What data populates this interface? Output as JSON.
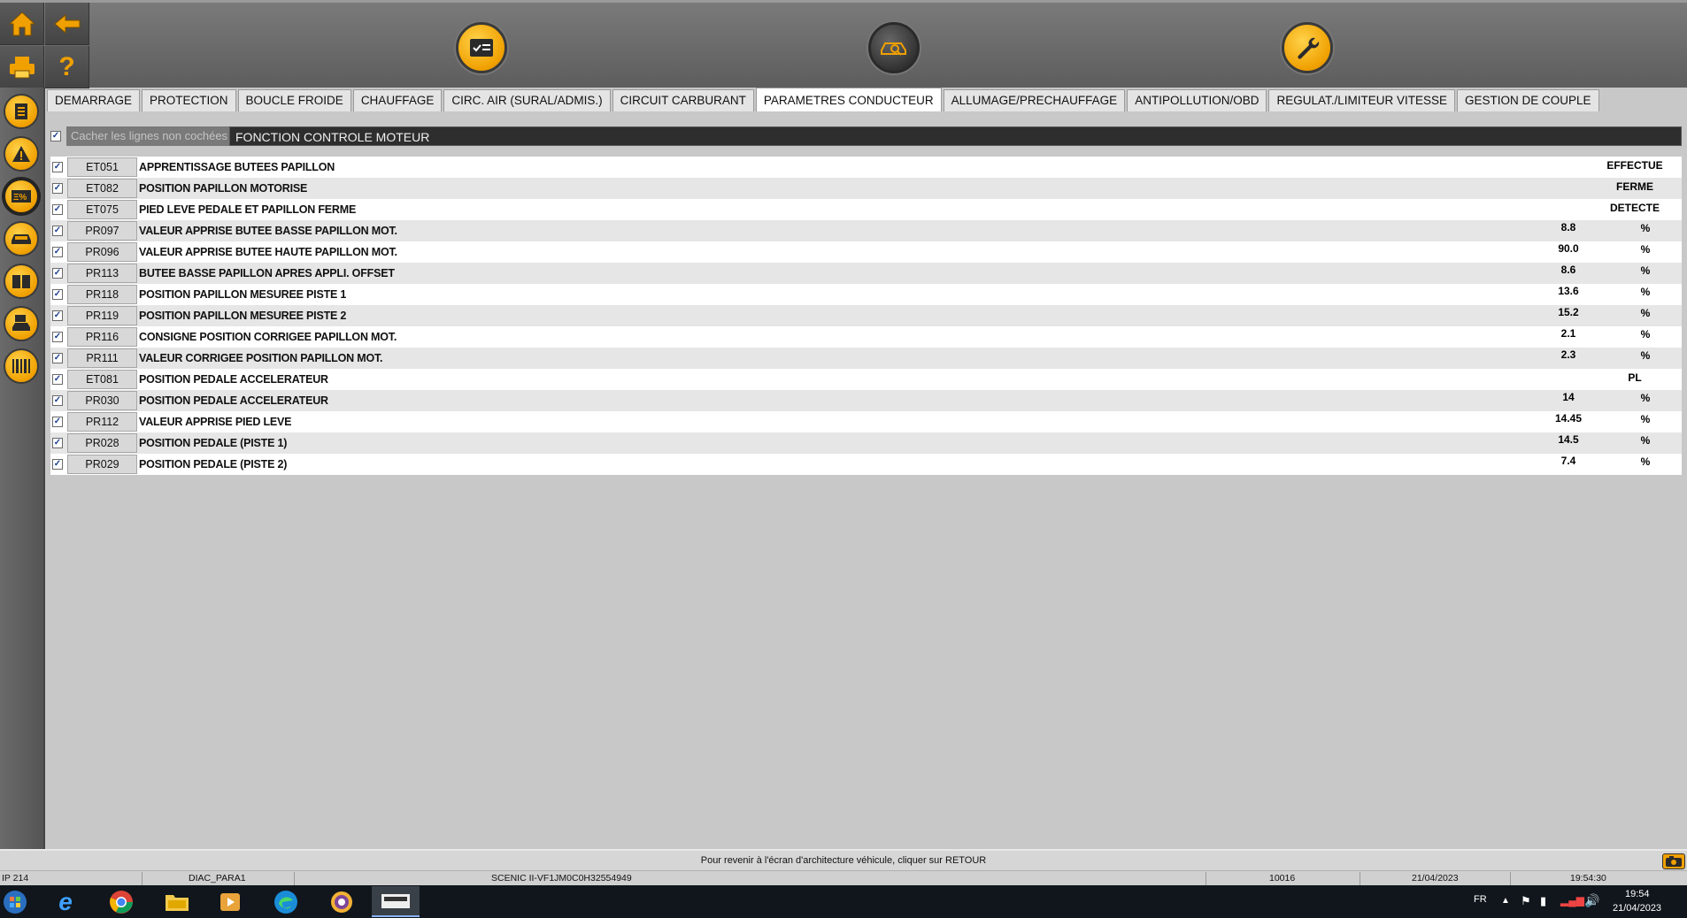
{
  "toolbar": {
    "icons": [
      "home-icon",
      "back-icon",
      "print-icon",
      "help-icon",
      "checklist-icon",
      "vehicle-diagnostic-icon",
      "wrench-icon"
    ]
  },
  "sidebar": {
    "icons": [
      "document-icon",
      "warning-icon",
      "parameters-icon",
      "vehicle-icon",
      "manual-icon",
      "vehicle-save-icon",
      "barcode-icon"
    ]
  },
  "tabs": [
    {
      "label": "DEMARRAGE"
    },
    {
      "label": "PROTECTION"
    },
    {
      "label": "BOUCLE FROIDE"
    },
    {
      "label": "CHAUFFAGE"
    },
    {
      "label": "CIRC. AIR (SURAL/ADMIS.)"
    },
    {
      "label": "CIRCUIT CARBURANT"
    },
    {
      "label": "PARAMETRES CONDUCTEUR",
      "active": true
    },
    {
      "label": "ALLUMAGE/PRECHAUFFAGE"
    },
    {
      "label": "ANTIPOLLUTION/OBD"
    },
    {
      "label": "REGULAT./LIMITEUR VITESSE"
    },
    {
      "label": "GESTION DE COUPLE"
    }
  ],
  "filter": {
    "hide_unchecked_label": "Cacher les lignes non cochées",
    "hide_unchecked_checked": true,
    "section_title": "FONCTION CONTROLE MOTEUR"
  },
  "rows": [
    {
      "code": "ET051",
      "label": "APPRENTISSAGE BUTEES PAPILLON",
      "status": "EFFECTUE"
    },
    {
      "code": "ET082",
      "label": "POSITION PAPILLON MOTORISE",
      "status": "FERME"
    },
    {
      "code": "ET075",
      "label": "PIED LEVE PEDALE ET PAPILLON FERME",
      "status": "DETECTE"
    },
    {
      "code": "PR097",
      "label": "VALEUR APPRISE BUTEE BASSE PAPILLON MOT.",
      "value": "8.8",
      "unit": "%"
    },
    {
      "code": "PR096",
      "label": "VALEUR APPRISE BUTEE HAUTE PAPILLON MOT.",
      "value": "90.0",
      "unit": "%"
    },
    {
      "code": "PR113",
      "label": "BUTEE BASSE PAPILLON APRES APPLI. OFFSET",
      "value": "8.6",
      "unit": "%"
    },
    {
      "code": "PR118",
      "label": "POSITION PAPILLON MESUREE PISTE 1",
      "value": "13.6",
      "unit": "%"
    },
    {
      "code": "PR119",
      "label": "POSITION PAPILLON MESUREE PISTE 2",
      "value": "15.2",
      "unit": "%"
    },
    {
      "code": "PR116",
      "label": "CONSIGNE POSITION CORRIGEE PAPILLON MOT.",
      "value": "2.1",
      "unit": "%"
    },
    {
      "code": "PR111",
      "label": "VALEUR CORRIGEE POSITION PAPILLON MOT.",
      "value": "2.3",
      "unit": "%"
    },
    {
      "code": "ET081",
      "label": "POSITION PEDALE ACCELERATEUR",
      "status": "PL"
    },
    {
      "code": "PR030",
      "label": "POSITION PEDALE ACCELERATEUR",
      "value": "14",
      "unit": "%"
    },
    {
      "code": "PR112",
      "label": "VALEUR APPRISE PIED LEVE",
      "value": "14.45",
      "unit": "%"
    },
    {
      "code": "PR028",
      "label": "POSITION PEDALE (PISTE 1)",
      "value": "14.5",
      "unit": "%"
    },
    {
      "code": "PR029",
      "label": "POSITION PEDALE (PISTE 2)",
      "value": "7.4",
      "unit": "%"
    }
  ],
  "status_message": "Pour revenir à l'écran d'architecture véhicule, cliquer sur RETOUR",
  "infobar": {
    "ip": "IP 214",
    "screen": "DIAC_PARA1",
    "vehicle": "SCENIC II-VF1JM0C0H32554949",
    "code": "10016",
    "date": "21/04/2023",
    "time": "19:54:30"
  },
  "taskbar": {
    "language": "FR",
    "clock_time": "19:54",
    "clock_date": "21/04/2023"
  },
  "colors": {
    "accent": "#f0a000",
    "toolbar": "#5d5d5d",
    "section_bg": "#2e2e2e"
  }
}
